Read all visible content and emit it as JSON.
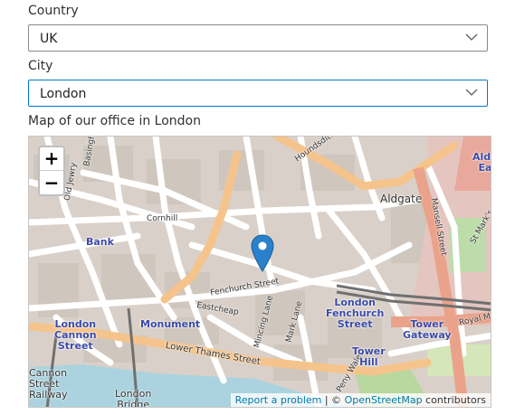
{
  "country": {
    "label": "Country",
    "value": "UK"
  },
  "city": {
    "label": "City",
    "value": "London"
  },
  "map": {
    "caption": "Map of our office in London",
    "zoom_in": "+",
    "zoom_out": "−",
    "attribution": {
      "report": "Report a problem",
      "sep": "| ©",
      "osm": "OpenStreetMap",
      "contrib": "contributors"
    },
    "places": {
      "bank": "Bank",
      "monument": "Monument",
      "aldgate": "Aldgate",
      "aldgate_east": "Aldg\nEa",
      "london_cannon_street": "London\nCannon\nStreet",
      "london_fenchurch_street": "London\nFenchurch\nStreet",
      "tower_gateway": "Tower\nGateway",
      "tower_hill": "Tower\nHill",
      "cannon_street_railway": "Cannon\nStreet\nRailway",
      "london_bridge": "London\nBridge"
    },
    "streets": {
      "cornhill": "Cornhill",
      "fenchurch": "Fenchurch Street",
      "eastcheap": "Eastcheap",
      "lower_thames": "Lower Thames Street",
      "mincing": "Mincing Lane",
      "mark": "Mark Lane",
      "mansell": "Mansell Street",
      "royal_mint": "Royal M",
      "houndsditch": "Houndsditch",
      "old_jewry": "Old Jewry",
      "basinghall": "Basinghall",
      "st_marks": "St Mark's",
      "peny_wales": "Peny Wales"
    }
  }
}
